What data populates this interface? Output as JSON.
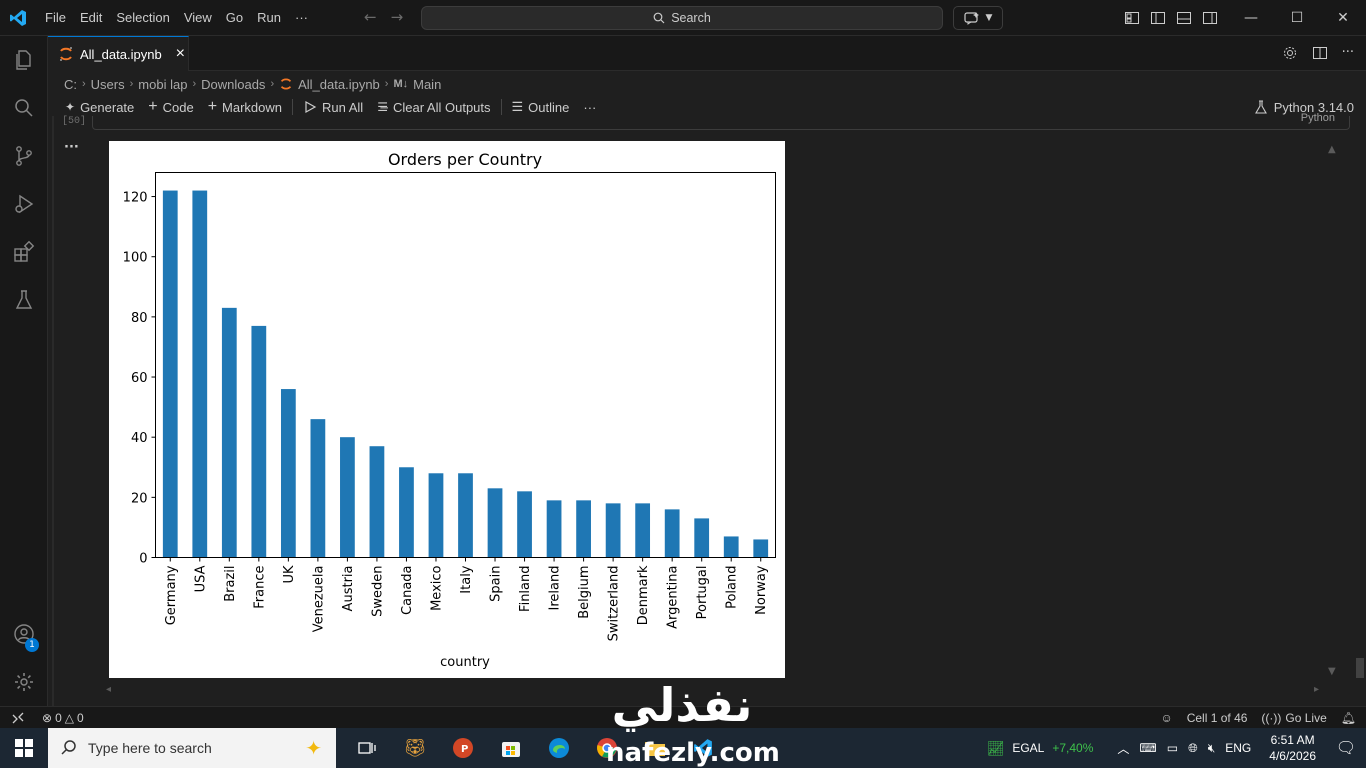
{
  "menu": [
    "File",
    "Edit",
    "Selection",
    "View",
    "Go",
    "Run",
    "···"
  ],
  "search": {
    "label": "Search"
  },
  "tab": {
    "title": "All_data.ipynb",
    "close": "×"
  },
  "breadcrumb": {
    "drive": "C:",
    "users": "Users",
    "user": "mobi lap",
    "downloads": "Downloads",
    "file": "All_data.ipynb",
    "section": "Main"
  },
  "toolbar": {
    "generate": "Generate",
    "code": "Code",
    "markdown": "Markdown",
    "run_all": "Run All",
    "clear": "Clear All Outputs",
    "outline": "Outline",
    "more": "···"
  },
  "kernel": {
    "label": "Python 3.14.0"
  },
  "cell": {
    "exec_count": "[50]",
    "lang": "Python",
    "output_dots": "···"
  },
  "chart_data": {
    "type": "bar",
    "title": "Orders per Country",
    "xlabel": "country",
    "ylabel": "",
    "ylim": [
      0,
      128
    ],
    "yticks": [
      0,
      20,
      40,
      60,
      80,
      100,
      120
    ],
    "categories": [
      "Germany",
      "USA",
      "Brazil",
      "France",
      "UK",
      "Venezuela",
      "Austria",
      "Sweden",
      "Canada",
      "Mexico",
      "Italy",
      "Spain",
      "Finland",
      "Ireland",
      "Belgium",
      "Switzerland",
      "Denmark",
      "Argentina",
      "Portugal",
      "Poland",
      "Norway"
    ],
    "values": [
      122,
      122,
      83,
      77,
      56,
      46,
      40,
      37,
      30,
      28,
      28,
      23,
      22,
      19,
      19,
      18,
      18,
      16,
      13,
      7,
      6
    ],
    "color": "#1f77b4",
    "grid": false
  },
  "status": {
    "errors": "0",
    "warnings": "0",
    "cell": "Cell 1 of 46",
    "golive": "Go Live"
  },
  "activity": {
    "account_badge": "1"
  },
  "taskbar": {
    "search_placeholder": "Type here to search",
    "stock_name": "EGAL",
    "stock_change": "+7,40%",
    "lang": "ENG",
    "time": "6:51 AM",
    "date": "4/6/2026"
  },
  "watermark": {
    "arabic": "نفذلي",
    "latin": "nafezly.com"
  }
}
